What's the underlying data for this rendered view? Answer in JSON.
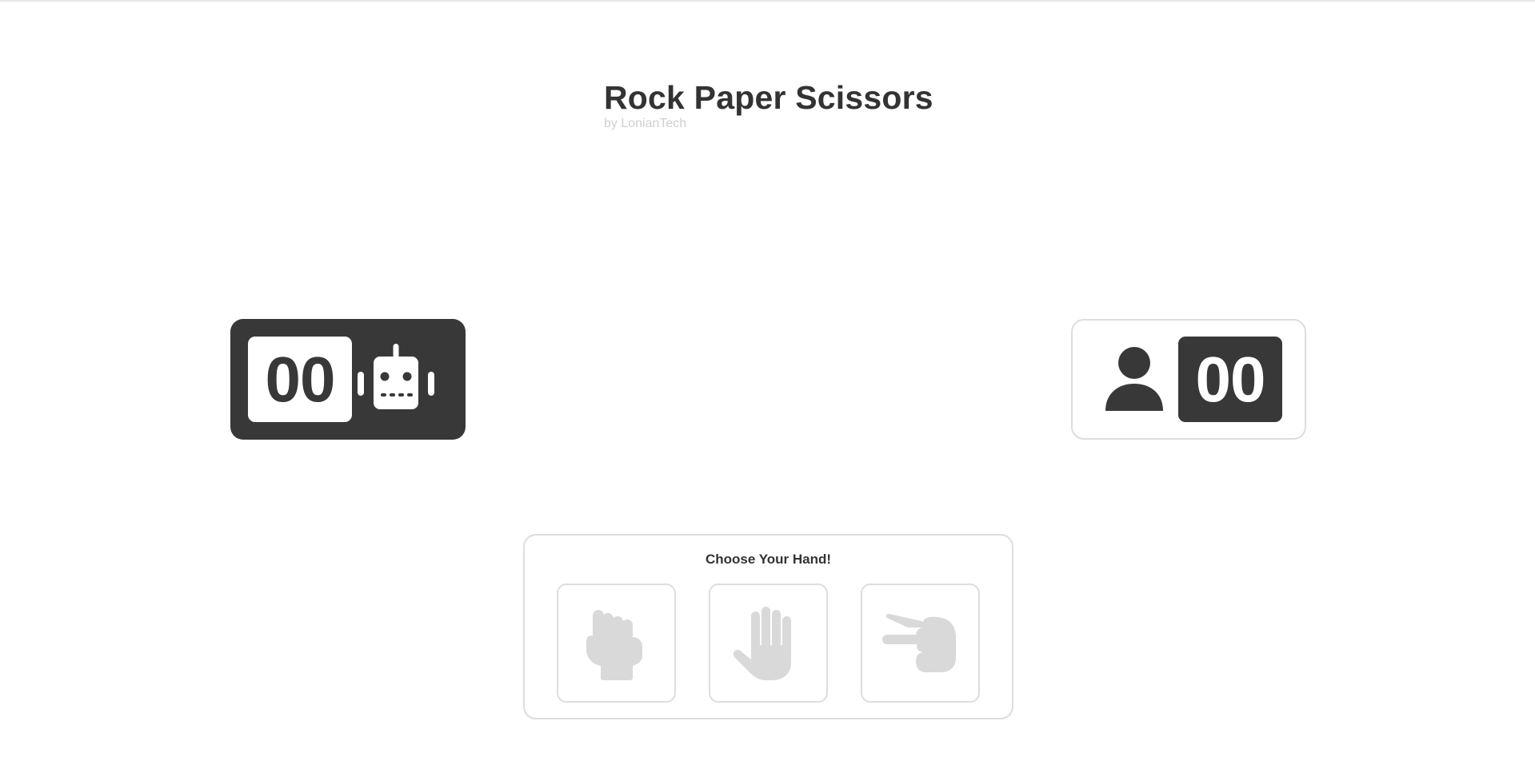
{
  "header": {
    "title": "Rock Paper Scissors",
    "subtitle": "by LonianTech"
  },
  "scoreboard": {
    "computer": {
      "score": "00",
      "icon": "robot-icon"
    },
    "player": {
      "score": "00",
      "icon": "user-icon"
    }
  },
  "chooser": {
    "label": "Choose Your Hand!",
    "options": [
      {
        "name": "rock",
        "icon": "hand-rock-icon"
      },
      {
        "name": "paper",
        "icon": "hand-paper-icon"
      },
      {
        "name": "scissors",
        "icon": "hand-scissors-icon"
      }
    ]
  },
  "colors": {
    "dark": "#383838",
    "light": "#ffffff",
    "border": "#dddddd",
    "muted_icon": "#d9d9d9",
    "subtitle": "#cfcfcf"
  }
}
